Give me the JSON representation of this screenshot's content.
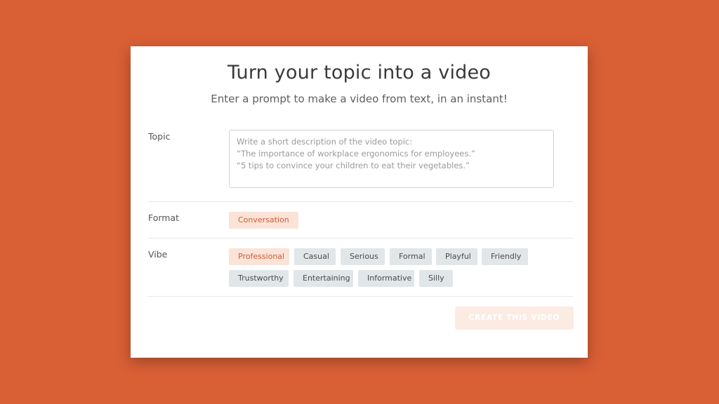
{
  "header": {
    "title": "Turn your topic into a video",
    "subtitle": "Enter a prompt to make a video from text, in an instant!"
  },
  "topic": {
    "label": "Topic",
    "placeholder": "Write a short description of the video topic:\n“The importance of workplace ergonomics for employees.”\n“5 tips to convince your children to eat their vegetables.”"
  },
  "format": {
    "label": "Format",
    "options": [
      {
        "label": "Conversation",
        "selected": true
      }
    ]
  },
  "vibe": {
    "label": "Vibe",
    "options": [
      {
        "label": "Professional",
        "selected": true
      },
      {
        "label": "Casual",
        "selected": false
      },
      {
        "label": "Serious",
        "selected": false
      },
      {
        "label": "Formal",
        "selected": false
      },
      {
        "label": "Playful",
        "selected": false
      },
      {
        "label": "Friendly",
        "selected": false
      },
      {
        "label": "Trustworthy",
        "selected": false
      },
      {
        "label": "Entertaining",
        "selected": false
      },
      {
        "label": "Informative",
        "selected": false
      },
      {
        "label": "Silly",
        "selected": false
      }
    ]
  },
  "actions": {
    "create_label": "CREATE THIS VIDEO"
  },
  "colors": {
    "background": "#d95f35",
    "accent": "#d35a30",
    "chip_selected_bg": "#fbe3d8",
    "chip_bg": "#e1e6e8"
  }
}
